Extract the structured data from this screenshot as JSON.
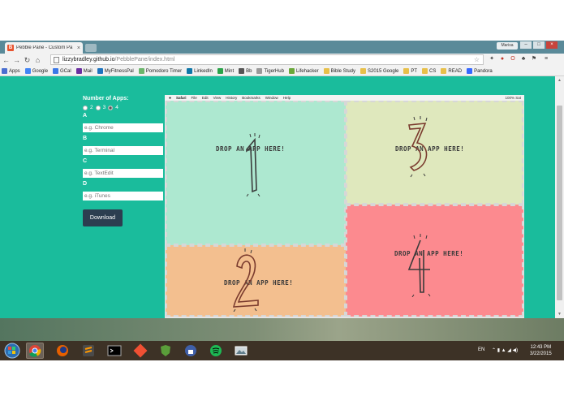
{
  "browser": {
    "tab_title": "Pebble Pane - Custom Pa",
    "tab_close": "×",
    "favicon_letter": "B",
    "user": "Marisa",
    "url_host": "lizzybradley.github.io",
    "url_path": "/PebblePane/index.html",
    "win_min": "–",
    "win_max": "□",
    "win_close": "×"
  },
  "bookmarks": [
    {
      "label": "Apps",
      "color": "#4a6fd0"
    },
    {
      "label": "Google",
      "color": "#4285f4"
    },
    {
      "label": "GCal",
      "color": "#3b78e7"
    },
    {
      "label": "Mail",
      "color": "#6b2fa0"
    },
    {
      "label": "MyFitnessPal",
      "color": "#1e73be"
    },
    {
      "label": "Pomodoro Timer",
      "color": "#6bb56b"
    },
    {
      "label": "LinkedIn",
      "color": "#0e76a8"
    },
    {
      "label": "Mint",
      "color": "#2aa34a"
    },
    {
      "label": "Bb",
      "color": "#555555"
    },
    {
      "label": "TigerHub",
      "color": "#999999"
    },
    {
      "label": "Lifehacker",
      "color": "#6aa83a"
    },
    {
      "label": "Bible Study",
      "color": "#e8c04a"
    },
    {
      "label": "S2015 Google",
      "color": "#e8c04a"
    },
    {
      "label": "PT",
      "color": "#e8c04a"
    },
    {
      "label": "CS",
      "color": "#e8c04a"
    },
    {
      "label": "READ",
      "color": "#e8c04a"
    },
    {
      "label": "Pandora",
      "color": "#3668ff"
    }
  ],
  "form": {
    "num_apps_label": "Number of Apps:",
    "options": [
      "2",
      "3",
      "4"
    ],
    "selected": "4",
    "fields": [
      {
        "label": "A",
        "placeholder": "e.g. Chrome"
      },
      {
        "label": "B",
        "placeholder": "e.g. Terminal"
      },
      {
        "label": "C",
        "placeholder": "e.g. TextEdit"
      },
      {
        "label": "D",
        "placeholder": "e.g. iTunes"
      }
    ],
    "download_label": "Download"
  },
  "mac_menu": {
    "apple": "",
    "items": [
      "Safari",
      "File",
      "Edit",
      "View",
      "History",
      "Bookmarks",
      "Window",
      "Help"
    ],
    "status": "100%  Sat"
  },
  "panes": [
    {
      "number": "1",
      "drop_text": "DROP AN APP HERE!",
      "color": "#ade8d0"
    },
    {
      "number": "2",
      "drop_text": "DROP AN APP HERE!",
      "color": "#f3bf8f"
    },
    {
      "number": "3",
      "drop_text": "DROP AN APP HERE!",
      "color": "#dfe8bd"
    },
    {
      "number": "4",
      "drop_text": "DROP AN APP HERE!",
      "color": "#fc8a8f"
    }
  ],
  "taskbar": {
    "lang": "EN",
    "time": "12:43 PM",
    "date": "3/22/2015"
  },
  "colors": {
    "page_bg": "#1abc9c",
    "button_bg": "#2c3e50"
  }
}
